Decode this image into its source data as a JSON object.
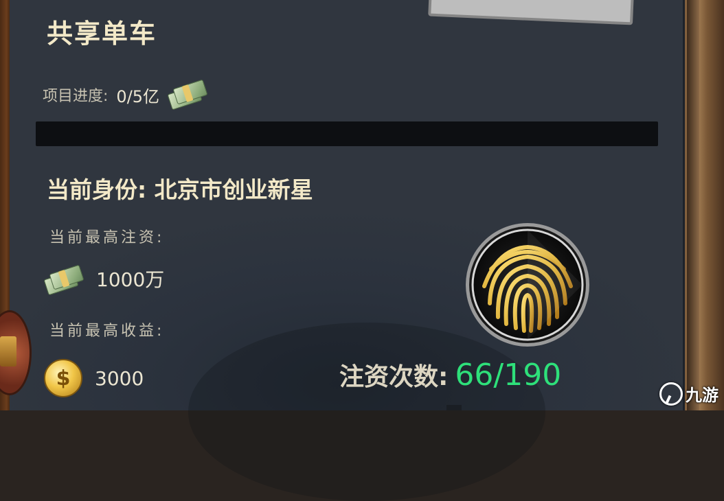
{
  "project": {
    "title": "共享单车",
    "progress_label": "项目进度:",
    "progress_value": "0/5亿",
    "progress_fraction": 0
  },
  "identity": {
    "text": "当前身份: 北京市创业新星"
  },
  "investment": {
    "label": "当前最高注资:",
    "value": "1000万"
  },
  "earnings": {
    "label": "当前最高收益:",
    "value": "3000"
  },
  "invest_count": {
    "label": "注资次数:",
    "value": "66/190"
  },
  "colors": {
    "accent_green": "#2ee07a",
    "title_cream": "#f3e9c8",
    "fingerprint_gold": "#e0b43c"
  },
  "icons": {
    "cash": "cash-stack-icon",
    "coin": "dollar-coin-icon",
    "fingerprint": "fingerprint-icon"
  },
  "watermark": {
    "text": "九游"
  }
}
